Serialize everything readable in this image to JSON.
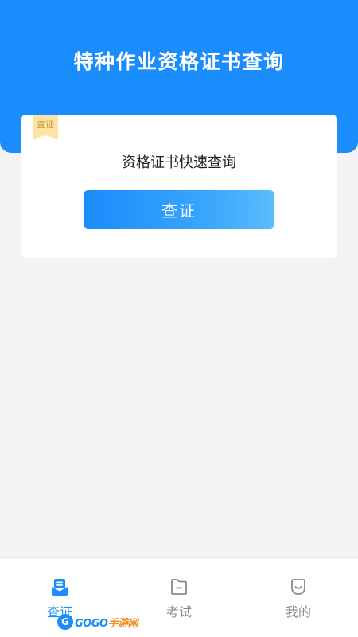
{
  "header": {
    "title": "特种作业资格证书查询"
  },
  "card": {
    "ribbon_label": "查证",
    "subtitle": "资格证书快速查询",
    "button_label": "查证"
  },
  "tabbar": {
    "tabs": [
      {
        "label": "查证",
        "icon": "inbox-icon",
        "active": true
      },
      {
        "label": "考试",
        "icon": "folder-icon",
        "active": false
      },
      {
        "label": "我的",
        "icon": "smile-icon",
        "active": false
      }
    ]
  },
  "watermark": {
    "text_main": "GOGO",
    "text_accent": "手游网",
    "circle": "G"
  },
  "colors": {
    "primary": "#1a8cfb",
    "ribbon": "#fde3a4",
    "background": "#f3f3f3"
  }
}
